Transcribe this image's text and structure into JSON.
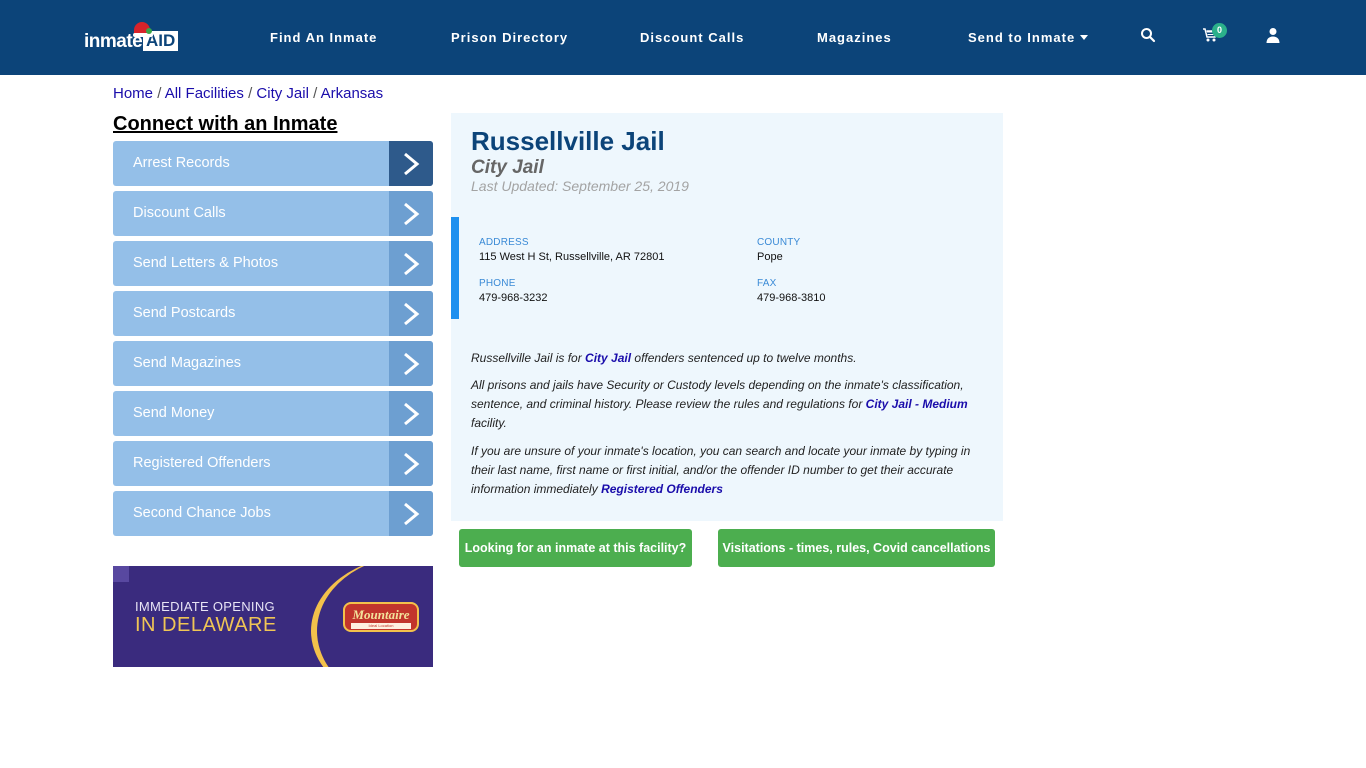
{
  "brand": {
    "logo_word": "inmate",
    "logo_aid": "AID"
  },
  "nav": {
    "items": [
      {
        "label": "Find An Inmate"
      },
      {
        "label": "Prison Directory"
      },
      {
        "label": "Discount Calls"
      },
      {
        "label": "Magazines"
      },
      {
        "label": "Send to Inmate",
        "has_dropdown": true
      }
    ],
    "icons": [
      "search-icon",
      "cart-icon",
      "user-icon"
    ],
    "cart_count": "0"
  },
  "breadcrumb": [
    {
      "label": "Home"
    },
    {
      "label": "All Facilities"
    },
    {
      "label": "City Jail"
    },
    {
      "label": "Arkansas"
    }
  ],
  "breadcrumb_sep": "/",
  "sidebar": {
    "title": "Connect with an Inmate",
    "items": [
      {
        "label": "Arrest Records",
        "active": true
      },
      {
        "label": "Discount Calls"
      },
      {
        "label": "Send Letters & Photos"
      },
      {
        "label": "Send Postcards"
      },
      {
        "label": "Send Magazines"
      },
      {
        "label": "Send Money"
      },
      {
        "label": "Registered Offenders"
      },
      {
        "label": "Second Chance Jobs"
      }
    ],
    "ad": {
      "line1": "IMMEDIATE OPENING",
      "line2": "IN DELAWARE",
      "brand": "Mountaire",
      "tagline": "Ideal Location"
    }
  },
  "facility": {
    "name": "Russellville Jail",
    "type": "City Jail",
    "last_updated": "Last Updated: September 25, 2019",
    "address_label": "ADDRESS",
    "address": "115 West H St, Russellville, AR 72801",
    "county_label": "COUNTY",
    "county": "Pope",
    "phone_label": "PHONE",
    "phone": "479-968-3232",
    "fax_label": "FAX",
    "fax": "479-968-3810"
  },
  "description": {
    "p1_a": "Russellville Jail is for ",
    "p1_link": "City Jail",
    "p1_b": " offenders sentenced up to twelve months.",
    "p2_a": "All prisons and jails have Security or Custody levels depending on the inmate's classification, sentence, and criminal history. Please review the rules and regulations for ",
    "p2_link": "City Jail - Medium",
    "p2_b": " facility.",
    "p3_a": "If you are unsure of your inmate's location, you can search and locate your inmate by typing in their last name, first name or first initial, and/or the offender ID number to get their accurate information immediately ",
    "p3_link": "Registered Offenders"
  },
  "buttons": {
    "find_inmate": "Looking for an inmate at this facility?",
    "visitations": "Visitations - times, rules, Covid cancellations"
  },
  "colors": {
    "navbar": "#0c4479",
    "sidebar_item": "#94bfe8",
    "sidebar_arrow": "#6d9fd1",
    "sidebar_arrow_active": "#2e5a8b",
    "card_bg": "#eef7fd",
    "info_accent": "#1e90ef",
    "button_green": "#4cae4f"
  }
}
